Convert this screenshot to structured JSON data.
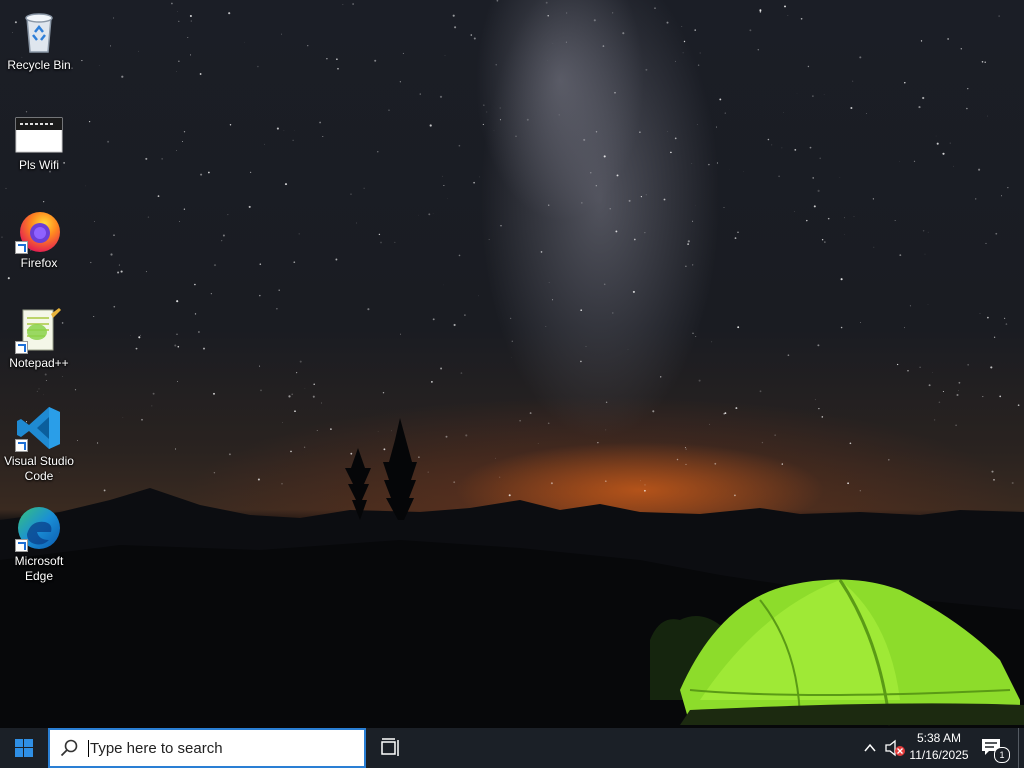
{
  "desktop": {
    "icons": [
      {
        "label": "Recycle Bin",
        "icon": "recycle-bin-icon"
      },
      {
        "label": "Pls Wifi",
        "icon": "image-file-icon"
      },
      {
        "label": "Firefox",
        "icon": "firefox-icon"
      },
      {
        "label": "Notepad++",
        "icon": "notepadpp-icon"
      },
      {
        "label": "Visual Studio Code",
        "icon": "vscode-icon"
      },
      {
        "label": "Microsoft Edge",
        "icon": "edge-icon"
      }
    ]
  },
  "taskbar": {
    "search_placeholder": "Type here to search",
    "clock_time": "5:38 AM",
    "clock_date": "11/16/2025",
    "notification_count": "1",
    "colors": {
      "background": "#1b2027",
      "accent": "#2a7fd4"
    }
  }
}
